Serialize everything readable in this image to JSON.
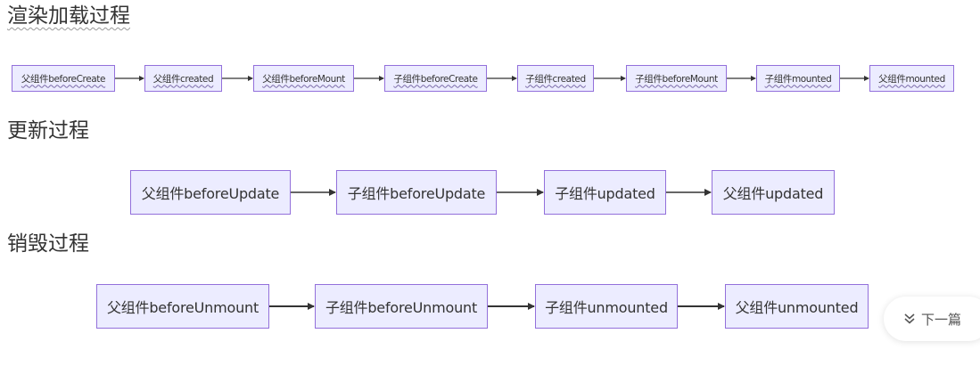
{
  "sections": {
    "render": {
      "title": "渲染加载过程",
      "nodes": [
        "父组件beforeCreate",
        "父组件created",
        "父组件beforeMount",
        "子组件beforeCreate",
        "子组件created",
        "子组件beforeMount",
        "子组件mounted",
        "父组件mounted"
      ]
    },
    "update": {
      "title": "更新过程",
      "nodes": [
        "父组件beforeUpdate",
        "子组件beforeUpdate",
        "子组件updated",
        "父组件updated"
      ]
    },
    "destroy": {
      "title": "销毁过程",
      "nodes": [
        "父组件beforeUnmount",
        "子组件beforeUnmount",
        "子组件unmounted",
        "父组件unmounted"
      ]
    }
  },
  "next_button": {
    "label": "下一篇",
    "icon": "double-chevron-down-icon"
  },
  "colors": {
    "node_fill": "#ececff",
    "node_border": "#9370db",
    "edge": "#333333"
  }
}
